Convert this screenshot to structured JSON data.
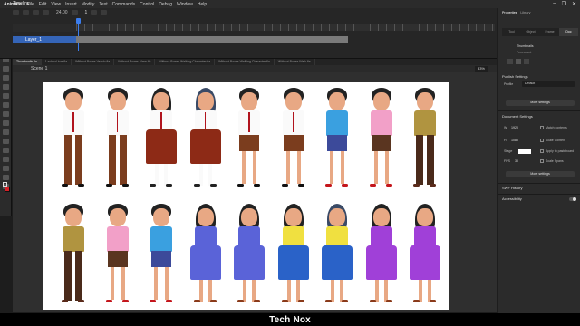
{
  "app": {
    "name": "Animate"
  },
  "menu": [
    "File",
    "Edit",
    "View",
    "Insert",
    "Modify",
    "Text",
    "Commands",
    "Control",
    "Debug",
    "Window",
    "Help"
  ],
  "window_controls": [
    "–",
    "❐",
    "✕"
  ],
  "timeline": {
    "tab_label": "Timeline",
    "fps": "24.00",
    "current_frame": "1",
    "layer_name": "Layer_1"
  },
  "documents": {
    "tabs": [
      "Thumbnails.fla",
      "1 school bus.fla",
      "Without Boxes Vendo.fla",
      "Without Boxes Mara.fla",
      "Without Boxes Walking Character.fla",
      "Without Boxes Walking Character.fla",
      "Without Boxes Walk.fla"
    ],
    "active_index": 0
  },
  "scene": {
    "label": "Scene 1",
    "zoom": "83%"
  },
  "tools": {
    "fill_color": "#d61f26",
    "stroke_color": "#ffffff"
  },
  "stage": {
    "background": "#ffffff"
  },
  "watermark": "Tech Nox",
  "properties": {
    "tabs": [
      "Properties",
      "Library"
    ],
    "active_tab": "Properties",
    "subtabs": [
      "Tool",
      "Object",
      "Frame",
      "Doc"
    ],
    "active_subtab": "Doc",
    "doc_name": "Thumbnails",
    "doc_kind": "Document",
    "publish_settings": {
      "heading": "Publish Settings",
      "profile_label": "Profile",
      "profile_value": "Default",
      "more_button": "More settings"
    },
    "document_settings": {
      "heading": "Document Settings",
      "width_label": "W",
      "width": "1920",
      "height_label": "H",
      "height": "1080",
      "match_contents": "Match contents",
      "scale_content": "Scale Content",
      "stage_label": "Stage",
      "apply_pasteboard": "Apply to pasteboard",
      "fps_label": "FPS",
      "fps": "30",
      "scale_spans": "Scale Spans",
      "more_button": "More settings"
    },
    "swf_history": "SWF History",
    "accessibility": "Accessibility"
  }
}
